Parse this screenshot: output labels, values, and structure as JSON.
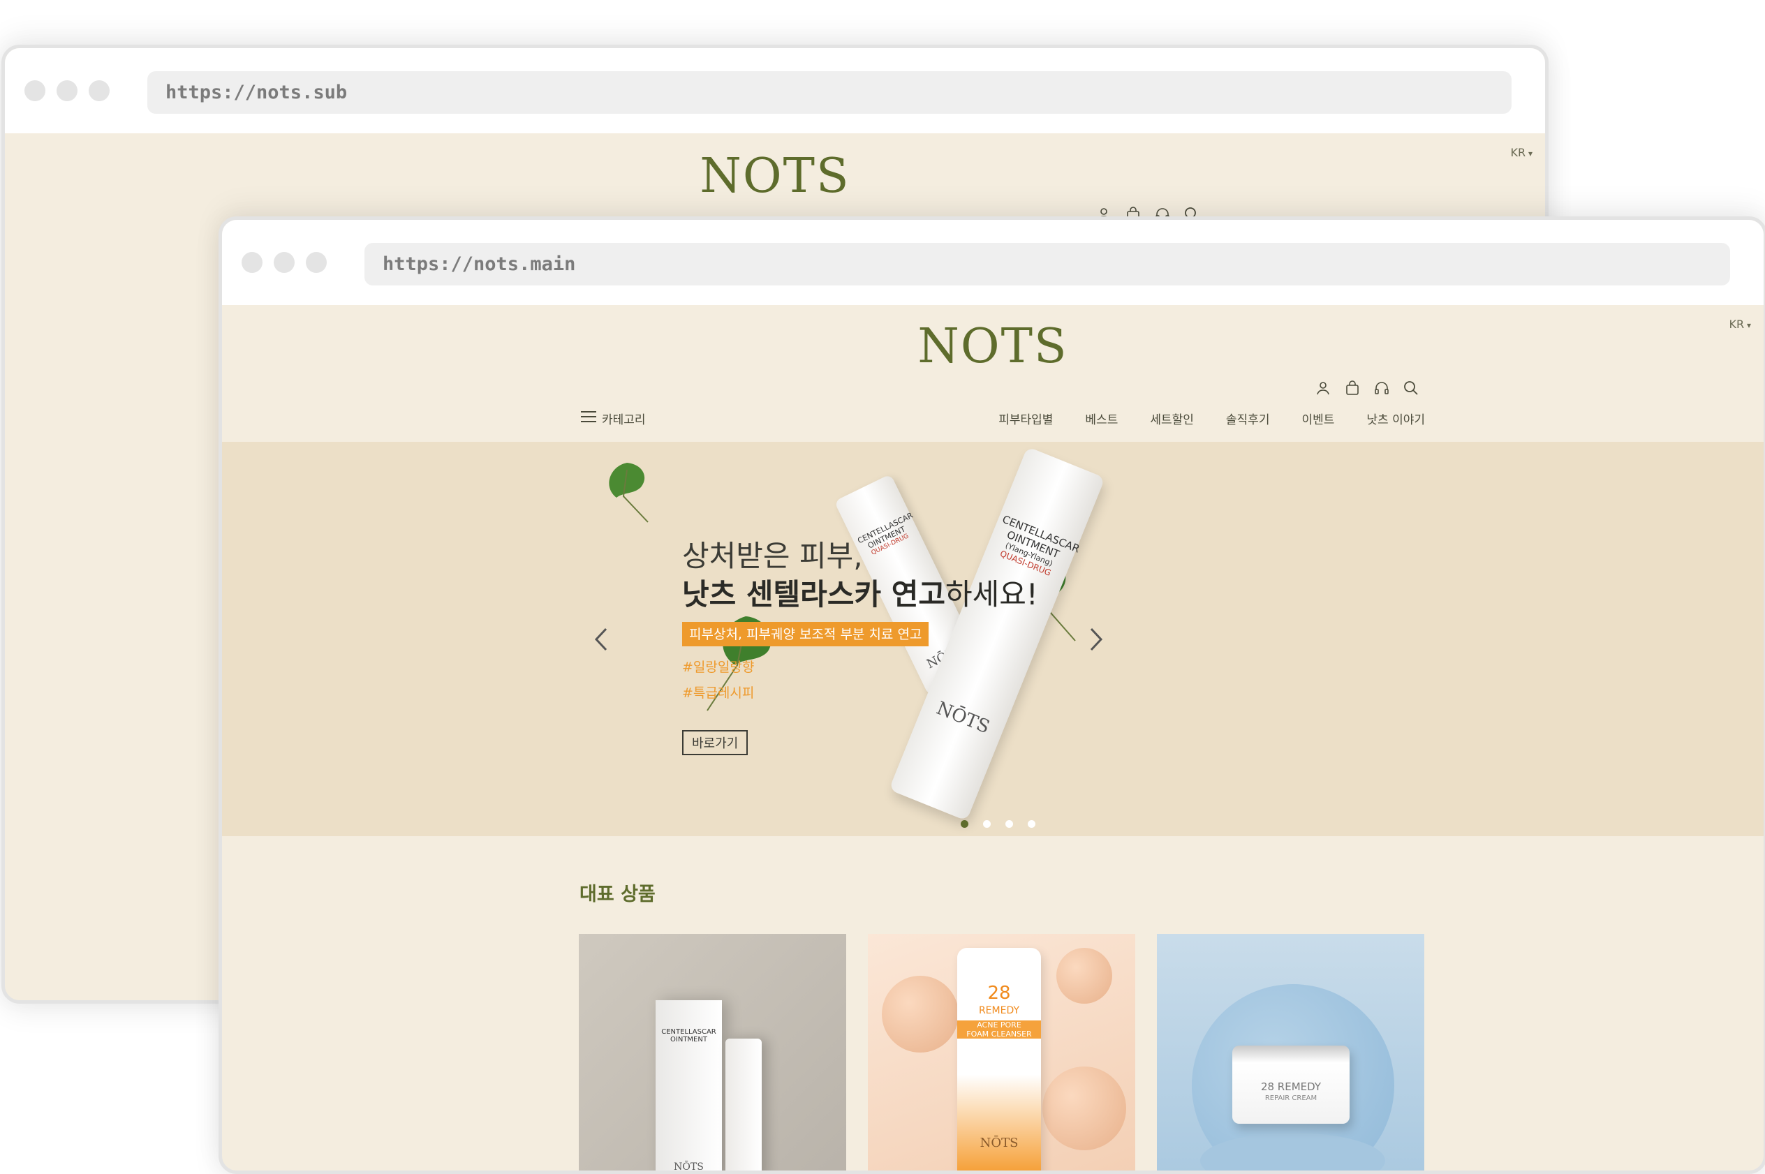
{
  "back_window": {
    "url": "https://nots.sub",
    "lang": "KR",
    "logo": "NOTS"
  },
  "front_window": {
    "url": "https://nots.main",
    "lang": "KR",
    "logo": "NOTS",
    "icons": [
      "user-icon",
      "cart-icon",
      "headset-icon",
      "search-icon"
    ],
    "nav": {
      "category_label": "카테고리",
      "items": [
        "피부타입별",
        "베스트",
        "세트할인",
        "솔직후기",
        "이벤트",
        "낫츠 이야기"
      ]
    },
    "hero": {
      "line1": "상처받은 피부,",
      "line2_bold": "낫츠 센텔라스카 연고",
      "line2_rest": "하세요!",
      "badge": "피부상처, 피부궤양 보조적 부분 치료 연고",
      "tags": [
        "#일랑일랑향",
        "#특급레시피"
      ],
      "cta": "바로가기",
      "product_text": {
        "name_line1": "CENTELLASCAR",
        "name_line2": "OINTMENT",
        "variant": "(Ylang-Ylang)",
        "type": "QUASI-DRUG",
        "brand": "NŌTS"
      },
      "pagination": {
        "count": 4,
        "active": 0
      }
    },
    "section_title": "대표 상품",
    "products": [
      {
        "label_line1": "CENTELLASCAR",
        "label_line2": "OINTMENT",
        "brand": "NŌTS"
      },
      {
        "label_line1": "28",
        "label_line2": "REMEDY",
        "label_line3": "ACNE PORE",
        "label_line4": "FOAM CLEANSER",
        "brand": "NŌTS"
      },
      {
        "label_line1": "28 REMEDY",
        "label_line2": "REPAIR CREAM"
      }
    ]
  },
  "colors": {
    "brand_green": "#5e6c2c",
    "page_bg": "#f4eddf",
    "hero_bg": "#ecdfc7",
    "accent_orange": "#ee9a2c"
  }
}
